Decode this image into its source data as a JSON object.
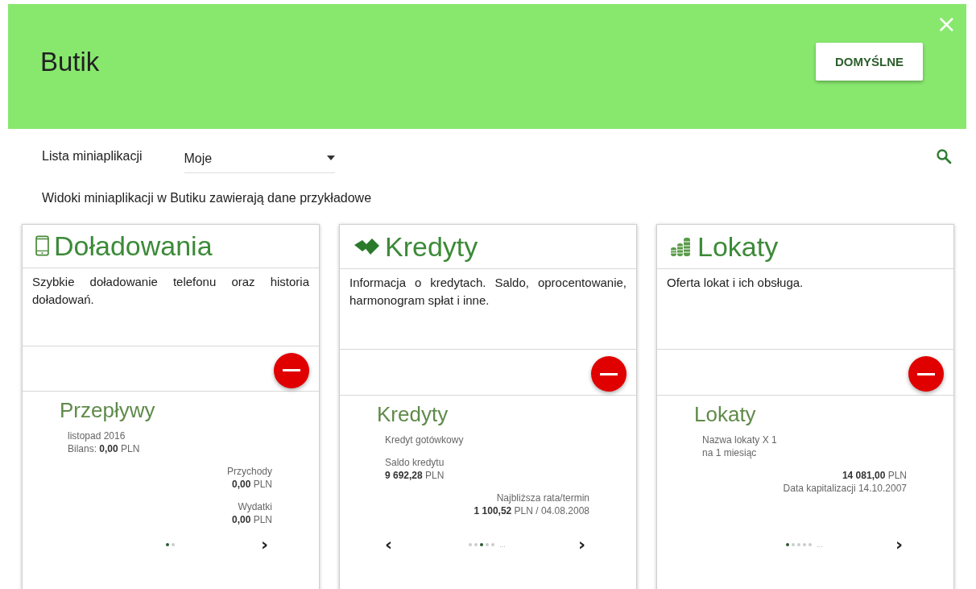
{
  "header": {
    "title": "Butik",
    "default_button": "DOMYŚLNE",
    "close": "×"
  },
  "filter": {
    "label": "Lista miniaplikacji",
    "value": "Moje"
  },
  "notice": "Widoki miniaplikacji w Butiku zawierają dane przykładowe",
  "cards": [
    {
      "title": "Doładowania",
      "description": "Szybkie doładowanie telefonu oraz historia doładowań.",
      "preview": {
        "title": "Przepływy",
        "left": [
          [
            "listopad 2016",
            "Bilans: **0,00** PLN"
          ]
        ],
        "right": [
          [
            "Przychody",
            "**0,00** PLN"
          ],
          [
            "Wydatki",
            "**0,00** PLN"
          ]
        ],
        "dots": [
          {
            "selected": true
          },
          {
            "selected": false
          }
        ],
        "next": "›"
      }
    },
    {
      "title": "Kredyty",
      "description": "Informacja o kredytach. Saldo, oprocentowanie, harmonogram spłat i inne.",
      "preview": {
        "title": "Kredyty",
        "left": [
          [
            "Kredyt gotówkowy"
          ],
          [
            "Saldo kredytu",
            "**9 692,28** PLN"
          ]
        ],
        "right": [
          [
            "Najbliższa rata/termin",
            "**1 100,52** PLN / 04.08.2008"
          ]
        ],
        "dots": [
          {
            "selected": false
          },
          {
            "selected": false
          },
          {
            "selected": true
          },
          {
            "selected": false
          },
          {
            "selected": false
          }
        ],
        "more": "...",
        "prev": "‹",
        "next": "›"
      }
    },
    {
      "title": "Lokaty",
      "description": "Oferta lokat i ich obsługa.",
      "preview": {
        "title": "Lokaty",
        "left": [
          [
            "Nazwa lokaty X 1",
            "na 1 miesiąc"
          ]
        ],
        "right": [
          [
            "**14 081,00** PLN",
            "Data kapitalizacji 14.10.2007"
          ]
        ],
        "dots": [
          {
            "selected": true
          },
          {
            "selected": false
          },
          {
            "selected": false
          },
          {
            "selected": false
          },
          {
            "selected": false
          }
        ],
        "more": "...",
        "next": "›"
      }
    }
  ]
}
